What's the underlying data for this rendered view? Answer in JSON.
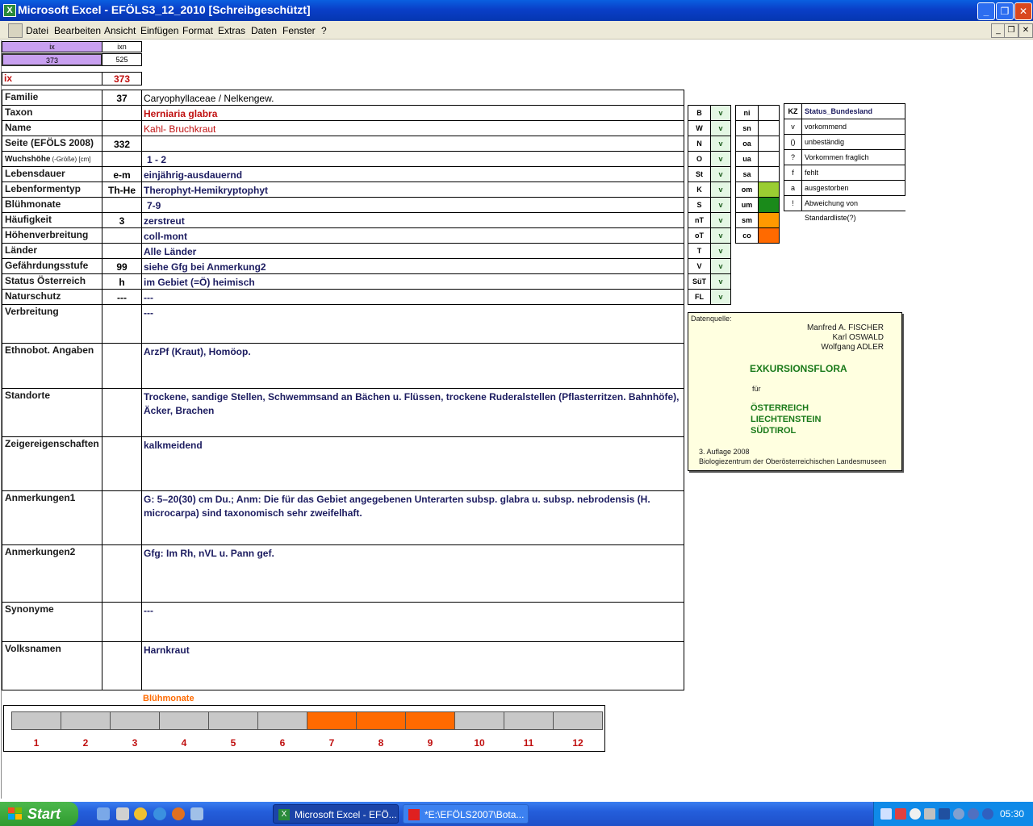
{
  "window": {
    "title": "Microsoft Excel - EFÖLS3_12_2010  [Schreibgeschützt]",
    "app_icon": "X"
  },
  "menu": [
    "Datei",
    "Bearbeiten",
    "Ansicht",
    "Einfügen",
    "Format",
    "Extras",
    "Daten",
    "Fenster",
    "?"
  ],
  "top": {
    "ix_head": "ix",
    "ixn_head": "ixn",
    "ix_val": "373",
    "ixn_val": "525",
    "ix_label": "ix",
    "ix_value": "373"
  },
  "rows": [
    {
      "label": "Familie",
      "num": "37",
      "value": "Caryophyllaceae  /  Nelkengew."
    },
    {
      "label": "Taxon",
      "num": "",
      "value": "Herniaria glabra"
    },
    {
      "label": "Name",
      "num": "",
      "value": "Kahl- Bruchkraut"
    },
    {
      "label": "Seite (EFÖLS 2008)",
      "num": "332",
      "value": ""
    },
    {
      "label": "Wuchshöhe",
      "label_small": "(-Größe) [cm]",
      "num": "",
      "value": "1 - 2"
    },
    {
      "label": "Lebensdauer",
      "num": "e-m",
      "value": "einjährig-ausdauernd"
    },
    {
      "label": "Lebenformentyp",
      "num": "Th-He",
      "value": "Therophyt-Hemikryptophyt"
    },
    {
      "label": "Blühmonate",
      "num": "",
      "value": "7-9"
    },
    {
      "label": "Häufigkeit",
      "num": "3",
      "value": "zerstreut"
    },
    {
      "label": "Höhenverbreitung",
      "num": "",
      "value": "coll-mont"
    },
    {
      "label": "Länder",
      "num": "",
      "value": "Alle Länder"
    },
    {
      "label": "Gefährdungsstufe",
      "num": "99",
      "value": "siehe Gfg bei Anmerkung2"
    },
    {
      "label": "Status Österreich",
      "num": "h",
      "value": "im Gebiet (=Ö) heimisch"
    },
    {
      "label": "Naturschutz",
      "num": "---",
      "value": "---"
    },
    {
      "label": "Verbreitung",
      "num": "",
      "value": "---"
    },
    {
      "label": "Ethnobot. Angaben",
      "num": "",
      "value": "ArzPf (Kraut), Homöop."
    },
    {
      "label": "Standorte",
      "num": "",
      "value": "Trockene, sandige Stellen, Schwemmsand an Bächen u. Flüssen, trockene Ruderalstellen (Pflasterritzen. Bahnhöfe), Äcker, Brachen"
    },
    {
      "label": "Zeigereigenschaften",
      "num": "",
      "value": " kalkmeidend"
    },
    {
      "label": "Anmerkungen1",
      "num": "",
      "value": "G: 5–20(30) cm Du.; Anm: Die für das Gebiet angegebenen Unterarten subsp. glabra u. subsp. nebrodensis (H. microcarpa) sind taxonomisch sehr zweifelhaft."
    },
    {
      "label": "Anmerkungen2",
      "num": "",
      "value": "Gfg: Im Rh, nVL u. Pann gef."
    },
    {
      "label": "Synonyme",
      "num": "",
      "value": "---"
    },
    {
      "label": "Volksnamen",
      "num": "",
      "value": "Harnkraut"
    }
  ],
  "bundesland": [
    {
      "code": "B",
      "v": "v"
    },
    {
      "code": "W",
      "v": "v"
    },
    {
      "code": "N",
      "v": "v"
    },
    {
      "code": "O",
      "v": "v"
    },
    {
      "code": "St",
      "v": "v"
    },
    {
      "code": "K",
      "v": "v"
    },
    {
      "code": "S",
      "v": "v"
    },
    {
      "code": "nT",
      "v": "v"
    },
    {
      "code": "oT",
      "v": "v"
    },
    {
      "code": "T",
      "v": "v"
    },
    {
      "code": "V",
      "v": "v"
    },
    {
      "code": "SüT",
      "v": "v"
    },
    {
      "code": "FL",
      "v": "v"
    }
  ],
  "hoehen": [
    {
      "code": "ni",
      "color": ""
    },
    {
      "code": "sn",
      "color": ""
    },
    {
      "code": "oa",
      "color": ""
    },
    {
      "code": "ua",
      "color": ""
    },
    {
      "code": "sa",
      "color": ""
    },
    {
      "code": "om",
      "color": "#9acd32"
    },
    {
      "code": "um",
      "color": "#1a8a1a"
    },
    {
      "code": "sm",
      "color": "#ff9900"
    },
    {
      "code": "co",
      "color": "#ff6a00"
    }
  ],
  "legend": {
    "kz_head": "KZ",
    "status_head": "Status_Bundesland",
    "items": [
      {
        "kz": "v",
        "text": "vorkommend"
      },
      {
        "kz": "()",
        "text": "unbeständig"
      },
      {
        "kz": "?",
        "text": "Vorkommen fraglich"
      },
      {
        "kz": "f",
        "text": "fehlt"
      },
      {
        "kz": "a",
        "text": "ausgestorben"
      },
      {
        "kz": "!",
        "text": "Abweichung von Standardliste(?)"
      }
    ]
  },
  "source": {
    "label": "Datenquelle:",
    "authors": [
      "Manfred A. FISCHER",
      "Karl OSWALD",
      "Wolfgang ADLER"
    ],
    "title": "EXKURSIONSFLORA",
    "fuer": "für",
    "countries": [
      "ÖSTERREICH",
      "LIECHTENSTEIN",
      "SÜDTIROL"
    ],
    "edition": "3. Auflage 2008",
    "publisher": "Biologiezentrum der Oberösterreichischen Landesmuseen"
  },
  "bloom": {
    "title": "Blühmonate",
    "months": [
      "1",
      "2",
      "3",
      "4",
      "5",
      "6",
      "7",
      "8",
      "9",
      "10",
      "11",
      "12"
    ],
    "active": [
      false,
      false,
      false,
      false,
      false,
      false,
      true,
      true,
      true,
      false,
      false,
      false
    ],
    "active_color": "#ff6a00",
    "inactive_color": "#c8c8c8"
  },
  "taskbar": {
    "start": "Start",
    "tasks": [
      "Microsoft Excel - EFÖ...",
      "*E:\\EFÖLS2007\\Bota..."
    ],
    "clock": "05:30"
  }
}
